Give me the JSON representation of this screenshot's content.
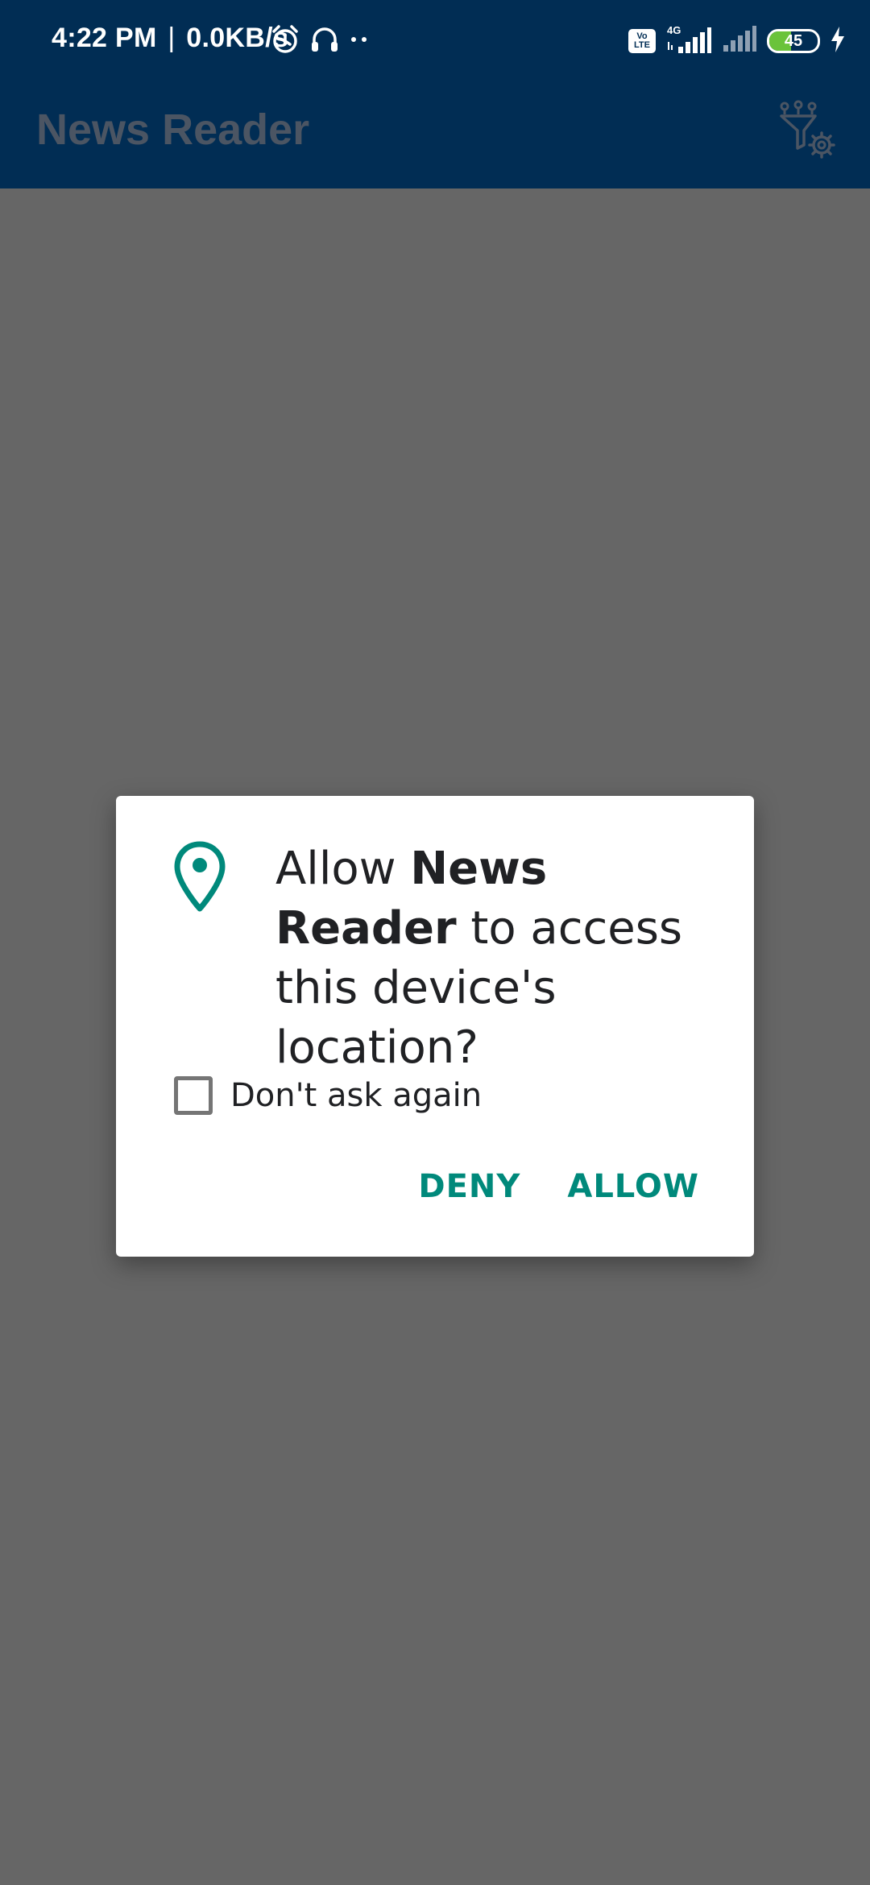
{
  "status_bar": {
    "time": "4:22 PM",
    "separator": "|",
    "network_speed": "0.0KB/s",
    "icons": [
      "alarm-icon",
      "headset-icon",
      "more-dots-icon",
      "volte-icon",
      "signal-4g-icon",
      "signal-weak-icon",
      "battery-icon",
      "charging-bolt-icon"
    ],
    "volte_label": "Vo LTE",
    "network_type": "4G",
    "battery_level": "45",
    "battery_fraction": 0.45,
    "battery_color": "#6ac33a"
  },
  "app_bar": {
    "title": "News Reader",
    "background_color": "#012d54",
    "settings_icon": "filter-settings-icon"
  },
  "dialog": {
    "icon": "location-pin-icon",
    "message_prefix": "Allow ",
    "app_name": "News Reader",
    "message_suffix": " to access this device's location?",
    "checkbox_label": "Don't ask again",
    "checkbox_checked": false,
    "deny_label": "DENY",
    "allow_label": "ALLOW",
    "accent_color": "#00897b"
  }
}
